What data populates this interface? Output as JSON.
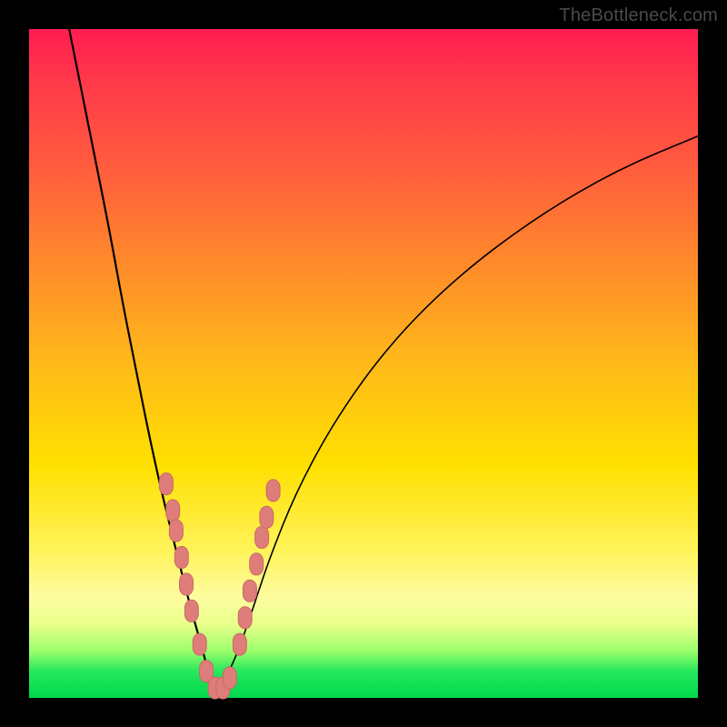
{
  "watermark": "TheBottleneck.com",
  "colors": {
    "frame": "#000000",
    "curve": "#000000",
    "marker_fill": "#de7d7a",
    "marker_stroke": "#c96a67"
  },
  "chart_data": {
    "type": "line",
    "title": "",
    "xlabel": "",
    "ylabel": "",
    "xlim": [
      0,
      100
    ],
    "ylim": [
      0,
      100
    ],
    "grid": false,
    "legend": false,
    "note": "V-shaped bottleneck curve; x and y are percent of plot width/height. y=0 is bottom (green), y=100 is top (red). Minimum near x≈28.",
    "series": [
      {
        "name": "left-branch",
        "x": [
          6,
          8,
          10,
          12,
          14,
          16,
          18,
          20,
          22,
          24,
          26,
          27,
          28
        ],
        "y": [
          100,
          90,
          80,
          70,
          59,
          49,
          39,
          30,
          22,
          14,
          7,
          3,
          1
        ]
      },
      {
        "name": "right-branch",
        "x": [
          28,
          30,
          32,
          34,
          36,
          40,
          46,
          54,
          64,
          76,
          88,
          100
        ],
        "y": [
          1,
          4,
          9,
          15,
          21,
          31,
          42,
          53,
          63,
          72,
          79,
          84
        ]
      }
    ],
    "markers": {
      "name": "highlighted-points",
      "note": "pink lozenge markers clustered along the lower V near the minimum",
      "points": [
        {
          "x": 20.5,
          "y": 32
        },
        {
          "x": 21.5,
          "y": 28
        },
        {
          "x": 22.0,
          "y": 25
        },
        {
          "x": 22.8,
          "y": 21
        },
        {
          "x": 23.5,
          "y": 17
        },
        {
          "x": 24.3,
          "y": 13
        },
        {
          "x": 25.5,
          "y": 8
        },
        {
          "x": 26.5,
          "y": 4
        },
        {
          "x": 27.8,
          "y": 1.5
        },
        {
          "x": 29.0,
          "y": 1.5
        },
        {
          "x": 30.0,
          "y": 3
        },
        {
          "x": 31.5,
          "y": 8
        },
        {
          "x": 32.3,
          "y": 12
        },
        {
          "x": 33.0,
          "y": 16
        },
        {
          "x": 34.0,
          "y": 20
        },
        {
          "x": 34.8,
          "y": 24
        },
        {
          "x": 35.5,
          "y": 27
        },
        {
          "x": 36.5,
          "y": 31
        }
      ]
    }
  }
}
